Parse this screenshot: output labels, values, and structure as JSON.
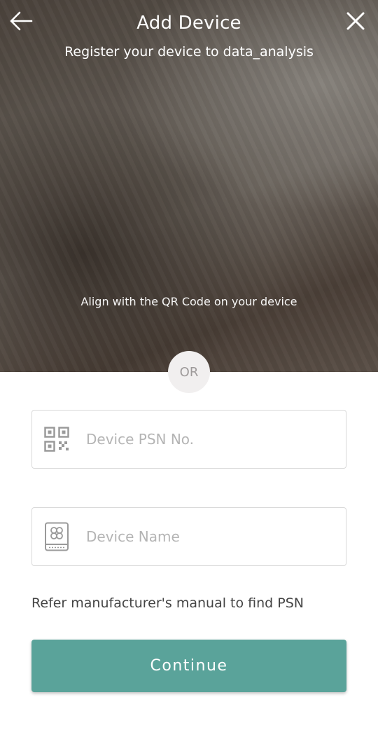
{
  "header": {
    "title": "Add Device",
    "subtitle": "Register your device to data_analysis",
    "back_icon": "arrow-left-icon",
    "close_icon": "close-icon"
  },
  "scanner": {
    "hint": "Align with the QR Code on your device"
  },
  "divider": {
    "label": "OR"
  },
  "form": {
    "psn_field": {
      "placeholder": "Device PSN No.",
      "value": "",
      "icon": "qr-code-icon"
    },
    "name_field": {
      "placeholder": "Device Name",
      "value": "",
      "icon": "device-icon"
    },
    "help_text": "Refer manufacturer's manual to find PSN",
    "continue_label": "Continue"
  },
  "colors": {
    "accent": "#5aa39a",
    "placeholder": "#b4b4b4",
    "border": "#d9d9d9",
    "or_badge_bg": "#f1efef"
  }
}
